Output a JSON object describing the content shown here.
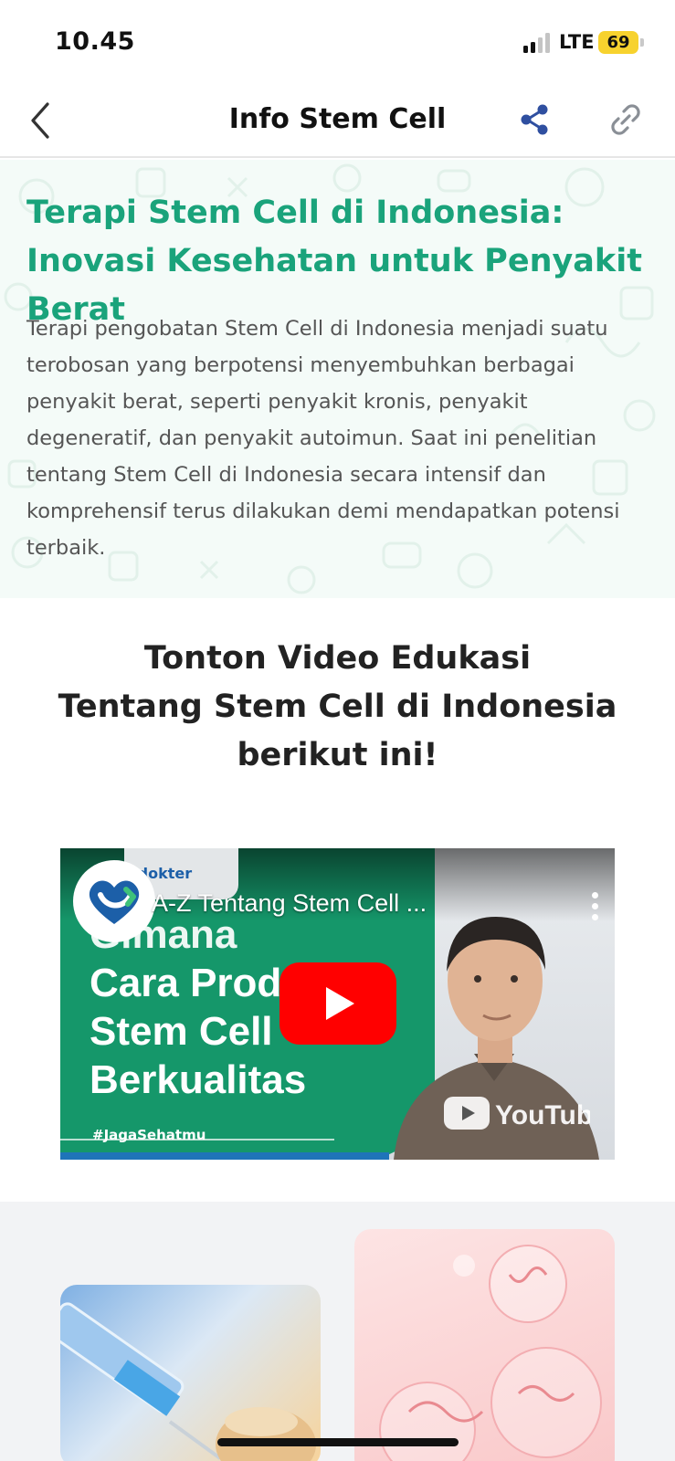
{
  "status_bar": {
    "time": "10.45",
    "network": "LTE",
    "battery": "69",
    "battery_color": "#f7d22e"
  },
  "nav": {
    "title": "Info Stem Cell",
    "back_icon": "chevron-left-icon",
    "share_icon": "share-icon",
    "link_icon": "link-icon",
    "share_color": "#2f4fa0"
  },
  "hero": {
    "title": "Terapi Stem Cell di Indonesia: Inovasi Kesehatan untuk Penyakit Berat",
    "body": "Terapi pengobatan Stem Cell di Indonesia menjadi suatu terobosan yang berpotensi menyembuhkan berbagai penyakit berat, seperti penyakit kronis, penyakit degeneratif, dan penyakit autoimun. Saat ini penelitian tentang Stem Cell di Indonesia secara intensif dan komprehensif terus dilakukan demi mendapatkan potensi terbaik.",
    "title_color": "#1aa37b"
  },
  "section": {
    "line1": "Tonton Video Edukasi",
    "line2": "Tentang Stem Cell di Indonesia",
    "line3": "berikut ini!"
  },
  "video": {
    "channel": "kdokter",
    "title": "A-Z Tentang Stem Cell ...",
    "lines": [
      "Gimana",
      "Cara Prod",
      "Stem Cell",
      "Berkualitas"
    ],
    "hashtag": "#JagaSehatmu",
    "platform": "YouTube",
    "play_color": "#ff0000"
  },
  "cards": {
    "left_icon": "vaccine-syringe-image",
    "right_icon": "dna-bubbles-image"
  }
}
